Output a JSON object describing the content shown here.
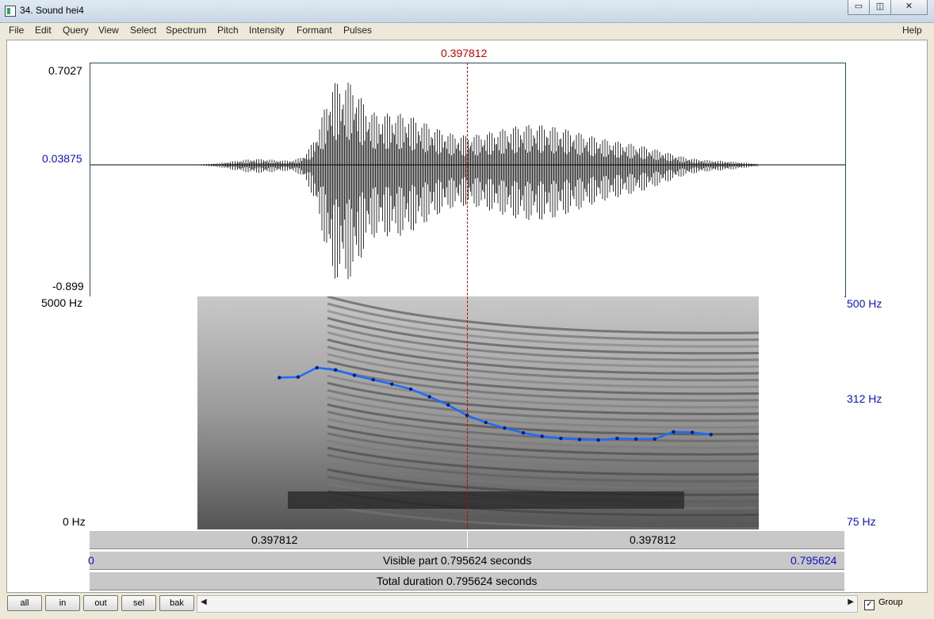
{
  "window": {
    "title": "34. Sound hei4",
    "controls": {
      "minimize": "▭",
      "maximize": "◫",
      "close": "✕"
    }
  },
  "menu": {
    "items": [
      "File",
      "Edit",
      "Query",
      "View",
      "Select",
      "Spectrum",
      "Pitch",
      "Intensity",
      "Formant",
      "Pulses"
    ],
    "help": "Help"
  },
  "cursor": {
    "time_label": "0.397812",
    "time": 0.397812
  },
  "waveform": {
    "ymax": "0.7027",
    "ymid": "0.03875",
    "ymin": "-0.899"
  },
  "spectrogram": {
    "freq_max": "5000 Hz",
    "freq_min": "0 Hz",
    "pitch_max": "500 Hz",
    "pitch_mid": "312 Hz",
    "pitch_min": "75 Hz"
  },
  "pitch_track": {
    "x_start": 0.2,
    "x_end": 0.655,
    "hz_points": [
      352,
      353,
      370,
      366,
      356,
      348,
      340,
      331,
      317,
      302,
      283,
      270,
      260,
      251,
      245,
      241,
      239,
      238,
      241,
      240,
      240,
      253,
      252,
      248
    ]
  },
  "time_bar": {
    "left_label": "0.397812",
    "right_label": "0.397812",
    "visible_start": "0",
    "visible_text": "Visible part 0.795624 seconds",
    "visible_end": "0.795624",
    "total_text": "Total duration 0.795624 seconds"
  },
  "buttons": {
    "all": "all",
    "in": "in",
    "out": "out",
    "sel": "sel",
    "bak": "bak"
  },
  "scroll": {
    "left": "◀",
    "right": "▶"
  },
  "group": {
    "label": "Group",
    "checked": "✓"
  },
  "colors": {
    "cursor": "#c00000",
    "pitch": "#1a6cff",
    "axis_blue": "#1010c0"
  }
}
